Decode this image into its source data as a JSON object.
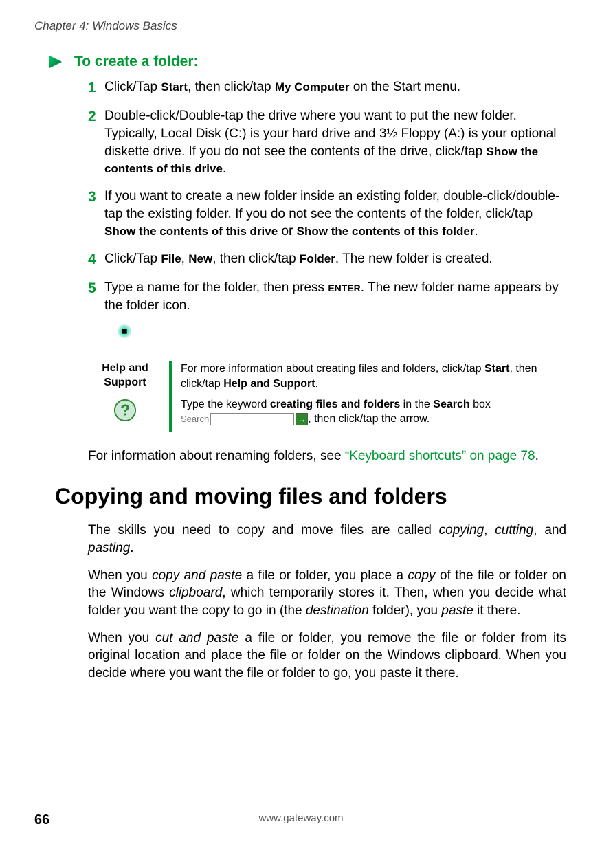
{
  "chapter": "Chapter 4: Windows Basics",
  "procedure": {
    "title": "To create a folder:",
    "steps": [
      {
        "num": "1",
        "pre": "Click/Tap ",
        "ui1": "Start",
        "mid1": ", then click/tap ",
        "ui2": "My Computer",
        "post": " on the Start menu."
      },
      {
        "num": "2",
        "pre": "Double-click/Double-tap the drive where you want to put the new folder. Typically, Local Disk (C:) is your hard drive and 3½ Floppy (A:) is your optional diskette drive. If you do not see the contents of the drive, click/tap ",
        "ui1": "Show the contents of this drive",
        "post": "."
      },
      {
        "num": "3",
        "pre": "If you want to create a new folder inside an existing folder, double-click/double-tap the existing folder. If you do not see the contents of the folder, click/tap ",
        "ui1": "Show the contents of this drive",
        "mid1": " or ",
        "ui2": "Show the contents of this folder",
        "post": "."
      },
      {
        "num": "4",
        "pre": "Click/Tap ",
        "ui1": "File",
        "mid1": ", ",
        "ui2": "New",
        "mid2": ", then click/tap ",
        "ui3": "Folder",
        "post": ". The new folder is created."
      },
      {
        "num": "5",
        "pre": "Type a name for the folder, then press ",
        "key": "ENTER",
        "post": ". The new folder name appears by the folder icon."
      }
    ]
  },
  "help": {
    "label_line1": "Help and",
    "label_line2": "Support",
    "p1_pre": "For more information about creating files and folders, click/tap ",
    "p1_ui1": "Start",
    "p1_mid": ", then click/tap ",
    "p1_ui2": "Help and Support",
    "p1_post": ".",
    "p2_pre": "Type the keyword ",
    "p2_kw": "creating files and folders",
    "p2_mid": " in the ",
    "p2_ui": "Search",
    "p2_mid2": " box ",
    "search_label": "Search",
    "p2_post": ", then click/tap the arrow."
  },
  "ref": {
    "pre": "For information about renaming folders, see ",
    "link": "“Keyboard shortcuts” on page 78",
    "post": "."
  },
  "section_title": "Copying and moving files and folders",
  "p1": {
    "a": "The skills you need to copy and move files are called ",
    "i1": "copying",
    "b": ", ",
    "i2": "cutting",
    "c": ", and ",
    "i3": "pasting",
    "d": "."
  },
  "p2": {
    "a": "When you ",
    "i1": "copy and paste",
    "b": " a file or folder, you place a ",
    "i2": "copy",
    "c": " of the file or folder on the Windows ",
    "i3": "clipboard",
    "d": ", which temporarily stores it. Then, when you decide what folder you want the copy to go in (the ",
    "i4": "destination",
    "e": " folder), you ",
    "i5": "paste",
    "f": " it there."
  },
  "p3": {
    "a": "When you ",
    "i1": "cut and paste",
    "b": " a file or folder, you remove the file or folder from its original location and place the file or folder on the Windows clipboard. When you decide where you want the file or folder to go, you paste it there."
  },
  "footer": {
    "page": "66",
    "url": "www.gateway.com"
  }
}
